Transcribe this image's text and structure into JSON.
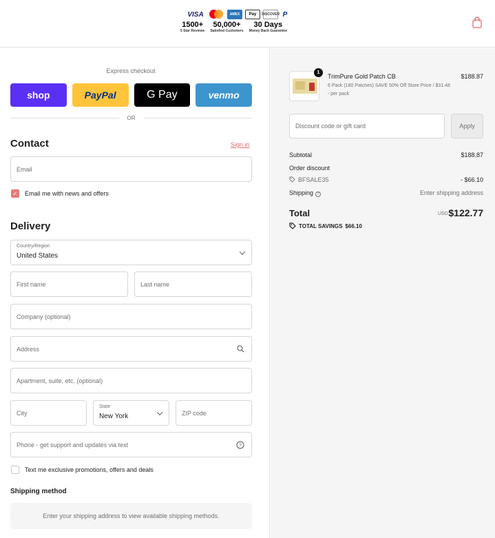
{
  "header": {
    "payment_icons": [
      "VISA",
      "mastercard",
      "AMEX",
      "Pay",
      "DISCOVER",
      "P"
    ],
    "stats": [
      {
        "value": "1500+",
        "caption": "5 Star Reviews"
      },
      {
        "value": "50,000+",
        "caption": "Satisfied Customers"
      },
      {
        "value": "30 Days",
        "caption": "Money Back Guarantee"
      }
    ],
    "cart_icon": "shopping-bag-icon"
  },
  "express": {
    "label": "Express checkout",
    "wallets": [
      "shop",
      "PayPal",
      "G Pay",
      "venmo"
    ],
    "or_text": "OR"
  },
  "contact": {
    "heading": "Contact",
    "sign_in": "Sign in",
    "email_placeholder": "Email",
    "newsletter_label": "Email me with news and offers",
    "newsletter_checked": true
  },
  "delivery": {
    "heading": "Delivery",
    "country_label": "Country/Region",
    "country_value": "United States",
    "first_name_placeholder": "First name",
    "last_name_placeholder": "Last name",
    "company_placeholder": "Company (optional)",
    "address_placeholder": "Address",
    "apartment_placeholder": "Apartment, suite, etc. (optional)",
    "city_placeholder": "City",
    "state_label": "State",
    "state_value": "New York",
    "zip_placeholder": "ZIP code",
    "phone_placeholder": "Phone - get support and updates via text",
    "sms_label": "Text me exclusive promotions, offers and deals",
    "sms_checked": false
  },
  "shipping": {
    "heading": "Shipping method",
    "message": "Enter your shipping address to view available shipping methods."
  },
  "summary": {
    "product": {
      "quantity": "1",
      "name": "TrimPure Gold Patch CB",
      "variant": "6 Pack (180 Patches) SAVE 50% Off Store Price / $31.48 - per pack",
      "price": "$188.87"
    },
    "discount_placeholder": "Discount code or gift card",
    "apply_label": "Apply",
    "subtotal_label": "Subtotal",
    "subtotal_value": "$188.87",
    "order_discount_label": "Order discount",
    "discount_code": "BFSALE35",
    "discount_value": "- $66.10",
    "shipping_label": "Shipping",
    "shipping_value": "Enter shipping address",
    "total_label": "Total",
    "currency": "USD",
    "total_value": "$122.77",
    "savings_label": "TOTAL SAVINGS",
    "savings_value": "$66.10"
  },
  "colors": {
    "shop": "#5a31f4",
    "paypal": "#ffc439",
    "gpay": "#000000",
    "venmo": "#3d95ce",
    "accent": "#e57b7b"
  }
}
